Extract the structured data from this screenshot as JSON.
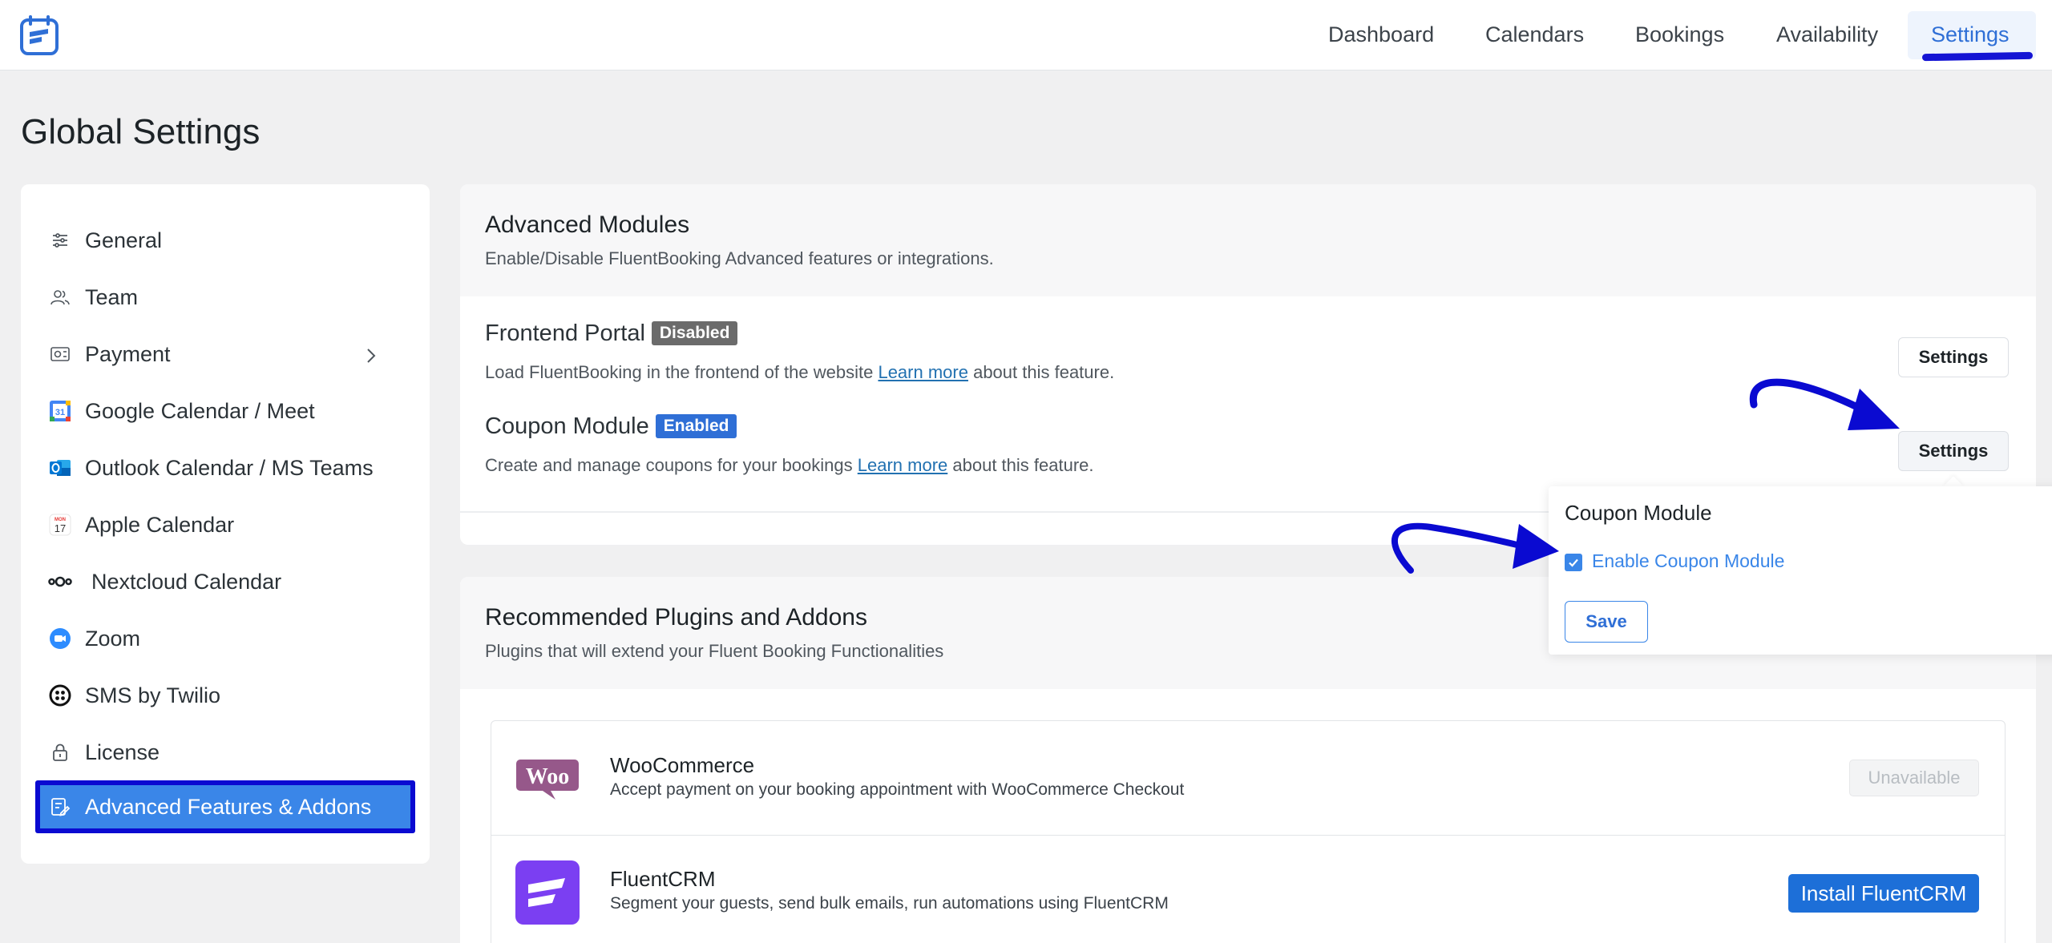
{
  "nav": {
    "items": [
      {
        "label": "Dashboard"
      },
      {
        "label": "Calendars"
      },
      {
        "label": "Bookings"
      },
      {
        "label": "Availability"
      },
      {
        "label": "Settings",
        "active": true
      }
    ]
  },
  "page": {
    "title": "Global Settings"
  },
  "sidebar": {
    "items": [
      {
        "label": "General",
        "icon": "sliders-icon"
      },
      {
        "label": "Team",
        "icon": "users-icon"
      },
      {
        "label": "Payment",
        "icon": "payment-icon",
        "has_chevron": true
      },
      {
        "label": "Google Calendar / Meet",
        "icon": "google-calendar-icon"
      },
      {
        "label": "Outlook Calendar / MS Teams",
        "icon": "outlook-icon"
      },
      {
        "label": "Apple Calendar",
        "icon": "apple-calendar-icon"
      },
      {
        "label": "Nextcloud Calendar",
        "icon": "nextcloud-icon"
      },
      {
        "label": "Zoom",
        "icon": "zoom-icon"
      },
      {
        "label": "SMS by Twilio",
        "icon": "twilio-icon"
      },
      {
        "label": "License",
        "icon": "lock-icon"
      },
      {
        "label": "Advanced Features & Addons",
        "icon": "addons-icon",
        "active": true
      }
    ]
  },
  "advanced": {
    "title": "Advanced Modules",
    "subtitle": "Enable/Disable FluentBooking Advanced features or integrations.",
    "modules": [
      {
        "title": "Frontend Portal",
        "status": "Disabled",
        "desc_before": "Load FluentBooking in the frontend of the website ",
        "link": "Learn more",
        "desc_after": " about this feature.",
        "button": "Settings"
      },
      {
        "title": "Coupon Module",
        "status": "Enabled",
        "desc_before": "Create and manage coupons for your bookings ",
        "link": "Learn more",
        "desc_after": " about this feature.",
        "button": "Settings"
      }
    ]
  },
  "popover": {
    "title": "Coupon Module",
    "checkbox_label": "Enable Coupon Module",
    "checked": true,
    "save": "Save"
  },
  "recommended": {
    "title": "Recommended Plugins and Addons",
    "subtitle": "Plugins that will extend your Fluent Booking Functionalities",
    "items": [
      {
        "name": "WooCommerce",
        "desc": "Accept payment on your booking appointment with WooCommerce Checkout",
        "button": "Unavailable",
        "logo_text": "Woo"
      },
      {
        "name": "FluentCRM",
        "desc": "Segment your guests, send bulk emails, run automations using FluentCRM",
        "button": "Install FluentCRM"
      }
    ]
  },
  "colors": {
    "primary": "#2f6fd6",
    "badge_disabled": "#6b6b6b",
    "badge_enabled": "#2f6fd6",
    "annotation": "#0a0ad1",
    "woo": "#96588a",
    "fluentcrm": "#7b3ff2"
  }
}
